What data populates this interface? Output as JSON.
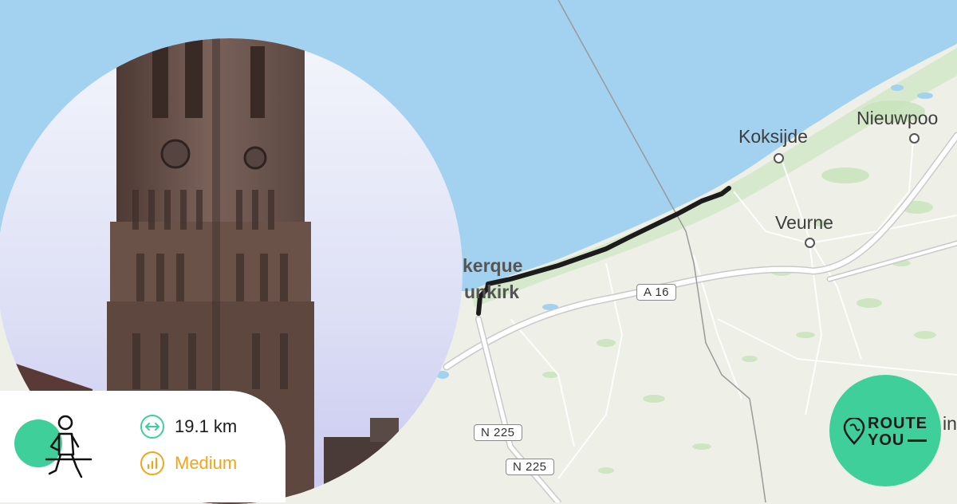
{
  "map": {
    "places": [
      {
        "id": "koksijde",
        "name": "Koksijde"
      },
      {
        "id": "nieuwpoort",
        "name": "Nieuwpoo"
      },
      {
        "id": "veurne",
        "name": "Veurne"
      },
      {
        "id": "dunkerque",
        "name": "kerque"
      },
      {
        "id": "dunkirk",
        "name": "unkirk"
      },
      {
        "id": "edge",
        "name": "in"
      }
    ],
    "roads": [
      "A 16",
      "N 225",
      "N 225"
    ],
    "colors": {
      "sea": "#a3d1f0",
      "land": "#eef0e8",
      "route": "#1c1c1c",
      "road": "#ffffff"
    }
  },
  "route_stats": {
    "activity": "running",
    "distance": "19.1 km",
    "difficulty": "Medium",
    "colors": {
      "distance_icon": "#3fcf9b",
      "difficulty": "#f2a51a",
      "activity_blob": "#3fcf9b"
    }
  },
  "logo": {
    "line1": "ROUTE",
    "line2": "YOU",
    "color": "#3fcf9b"
  },
  "photo": {
    "subject": "brick belfry tower"
  }
}
